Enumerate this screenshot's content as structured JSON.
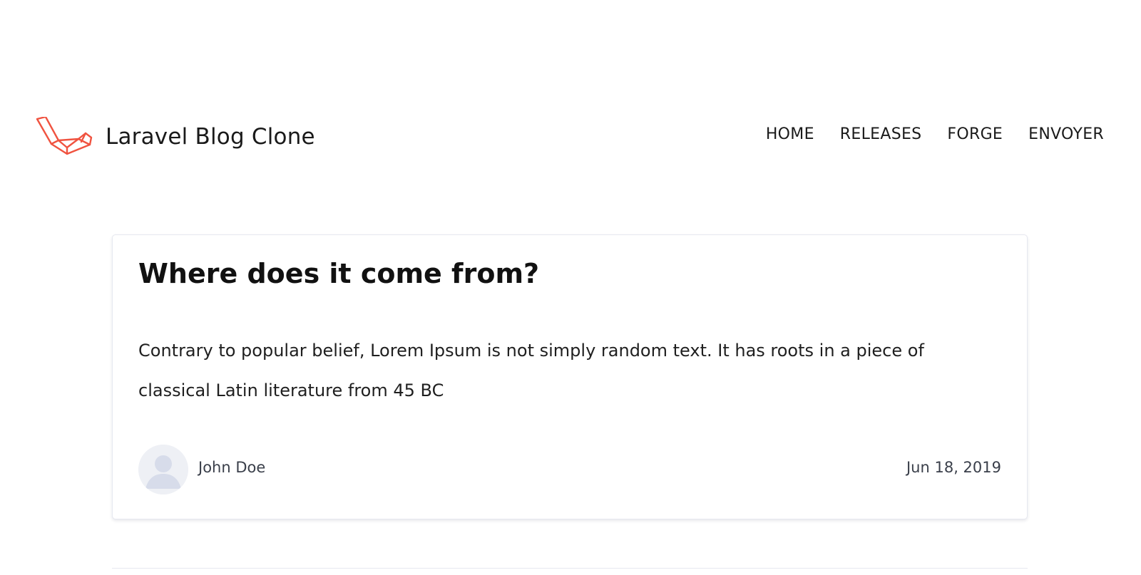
{
  "header": {
    "brand_name": "Laravel Blog Clone",
    "logo_icon": "laravel-logo-icon",
    "accent_color": "#F05340",
    "nav": [
      {
        "label": "HOME"
      },
      {
        "label": "RELEASES"
      },
      {
        "label": "FORGE"
      },
      {
        "label": "ENVOYER"
      }
    ]
  },
  "post": {
    "title": "Where does it come from?",
    "excerpt": "Contrary to popular belief, Lorem Ipsum is not simply random text. It has roots in a piece of classical Latin literature from 45 BC",
    "author": "John Doe",
    "avatar_icon": "user-avatar-icon",
    "date": "Jun 18, 2019"
  }
}
